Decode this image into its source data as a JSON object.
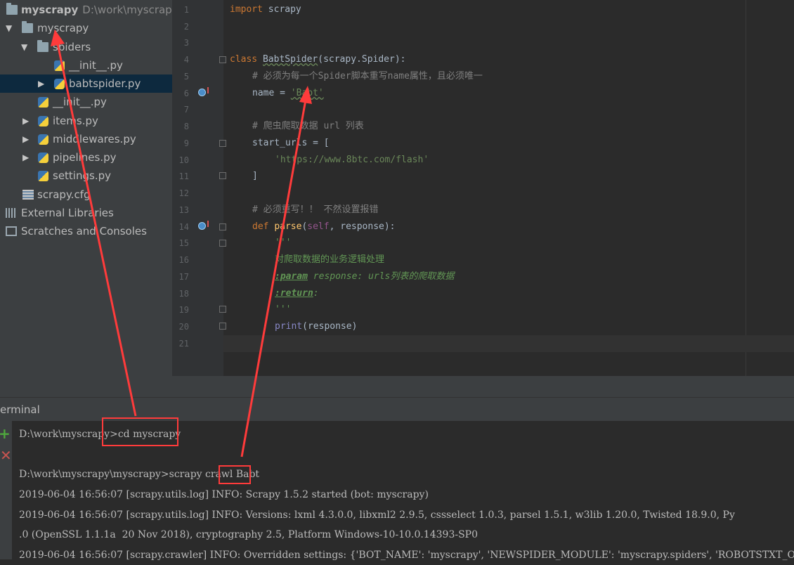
{
  "project_tree": {
    "root": {
      "name": "myscrapy",
      "path": "D:\\work\\myscrapy"
    },
    "items": [
      {
        "label": "myscrapy"
      },
      {
        "label": "spiders"
      },
      {
        "label": "__init__.py"
      },
      {
        "label": "babtspider.py"
      },
      {
        "label": "__init__.py"
      },
      {
        "label": "items.py"
      },
      {
        "label": "middlewares.py"
      },
      {
        "label": "pipelines.py"
      },
      {
        "label": "settings.py"
      },
      {
        "label": "scrapy.cfg"
      },
      {
        "label": "External Libraries"
      },
      {
        "label": "Scratches and Consoles"
      }
    ]
  },
  "editor": {
    "line_numbers": [
      "1",
      "2",
      "3",
      "4",
      "5",
      "6",
      "7",
      "8",
      "9",
      "10",
      "11",
      "12",
      "13",
      "14",
      "15",
      "16",
      "17",
      "18",
      "19",
      "20",
      "21"
    ],
    "code": {
      "l1_kw": "import",
      "l1_rest": " scrapy",
      "l4_kw": "class ",
      "l4_name": "BabtSpider",
      "l4_rest": "(scrapy.Spider):",
      "l5_comment": "# 必须为每一个Spider脚本重写name属性，且必须唯一",
      "l6_name": "name = ",
      "l6_str": "'Babt'",
      "l8_comment": "# 爬虫爬取数据 url 列表",
      "l9": "start_urls = [",
      "l10_str": "'https://www.8btc.com/flash'",
      "l11": "]",
      "l13_comment": "# 必须重写！！ 不然设置报错",
      "l14_kw": "def ",
      "l14_fn": "parse",
      "l14_open": "(",
      "l14_self": "self",
      "l14_rest": ", response):",
      "l15_doc": "'''",
      "l16_doc": "对爬取数据的业务逻辑处理",
      "l17_tag": ":param",
      "l17_doc": " response: urls列表的爬取数据",
      "l18_tag": ":return",
      "l18_doc": ":",
      "l19_doc": "'''",
      "l20_fn": "print",
      "l20_rest": "(response)"
    }
  },
  "terminal": {
    "title": "erminal",
    "lines": {
      "l1_prompt": "D:\\work\\myscrapy>",
      "l1_cmd": "cd myscrapy",
      "l2_prompt": "D:\\work\\myscrapy\\myscrapy>scrapy crawl ",
      "l2_arg": "Babt",
      "l3": "2019-06-04 16:56:07 [scrapy.utils.log] INFO: Scrapy 1.5.2 started (bot: myscrapy)",
      "l4": "2019-06-04 16:56:07 [scrapy.utils.log] INFO: Versions: lxml 4.3.0.0, libxml2 2.9.5, cssselect 1.0.3, parsel 1.5.1, w3lib 1.20.0, Twisted 18.9.0, Py",
      "l5": ".0 (OpenSSL 1.1.1a  20 Nov 2018), cryptography 2.5, Platform Windows-10-10.0.14393-SP0",
      "l6": "2019-06-04 16:56:07 [scrapy.crawler] INFO: Overridden settings: {'BOT_NAME': 'myscrapy', 'NEWSPIDER_MODULE': 'myscrapy.spiders', 'ROBOTSTXT_OBEY': T"
    }
  },
  "colors": {
    "annotation": "#ff3b3b",
    "tree_bg": "#3c3f41",
    "editor_bg": "#2b2b2b",
    "selection": "#0d293e"
  }
}
